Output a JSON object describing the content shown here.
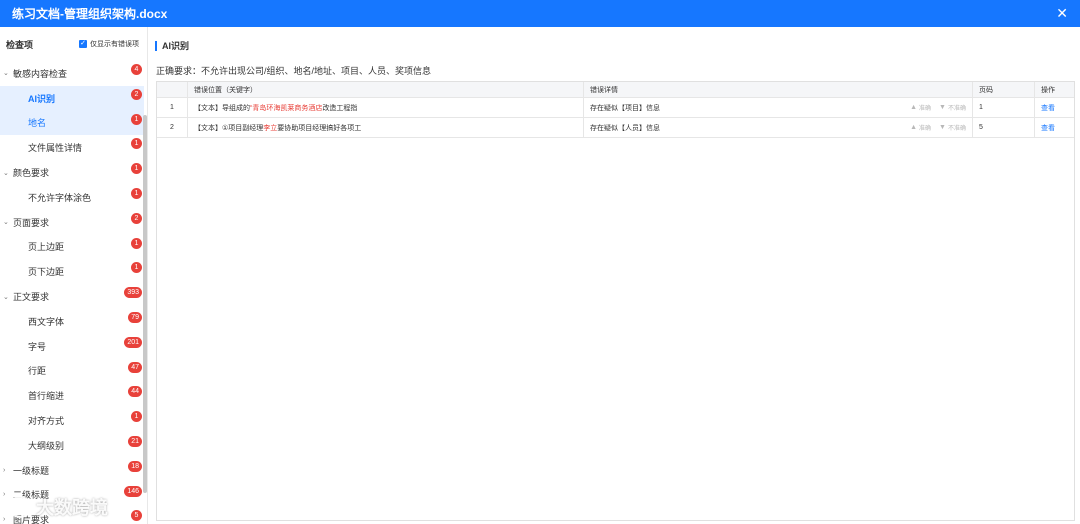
{
  "window": {
    "title": "练习文档-管理组织架构.docx"
  },
  "sidebar": {
    "header": "检查项",
    "filter_label": "仅显示有错误项",
    "items": [
      {
        "label": "敏感内容检查",
        "count": "4",
        "type": "group"
      },
      {
        "label": "AI识别",
        "count": "2",
        "type": "child"
      },
      {
        "label": "地名",
        "count": "1",
        "type": "child"
      },
      {
        "label": "文件属性详情",
        "count": "1",
        "type": "child"
      },
      {
        "label": "颜色要求",
        "count": "1",
        "type": "group"
      },
      {
        "label": "不允许字体涂色",
        "count": "1",
        "type": "child"
      },
      {
        "label": "页面要求",
        "count": "2",
        "type": "group"
      },
      {
        "label": "页上边距",
        "count": "1",
        "type": "child"
      },
      {
        "label": "页下边距",
        "count": "1",
        "type": "child"
      },
      {
        "label": "正文要求",
        "count": "393",
        "type": "group"
      },
      {
        "label": "西文字体",
        "count": "79",
        "type": "child"
      },
      {
        "label": "字号",
        "count": "201",
        "type": "child"
      },
      {
        "label": "行距",
        "count": "47",
        "type": "child"
      },
      {
        "label": "首行缩进",
        "count": "44",
        "type": "child"
      },
      {
        "label": "对齐方式",
        "count": "1",
        "type": "child"
      },
      {
        "label": "大纲级别",
        "count": "21",
        "type": "child"
      },
      {
        "label": "一级标题",
        "count": "18",
        "type": "group"
      },
      {
        "label": "二级标题",
        "count": "146",
        "type": "group"
      },
      {
        "label": "图片要求",
        "count": "5",
        "type": "group"
      }
    ]
  },
  "main": {
    "section_title": "AI识别",
    "requirement": "正确要求：不允许出现公司/组织、地名/地址、项目、人员、奖项信息",
    "table": {
      "headers": {
        "index": "",
        "location": "错误位置（关键字）",
        "detail": "错误详情",
        "page": "页码",
        "action": "操作"
      },
      "rows": [
        {
          "index": "1",
          "prefix": "【文本】导组成的",
          "keyword": "“青岛环海凯莱商务酒店",
          "suffix": "改造工程指",
          "detail": "存在疑似【项目】信息",
          "accurate": "准确",
          "inaccurate": "不准确",
          "page": "1",
          "action": "查看"
        },
        {
          "index": "2",
          "prefix": "【文本】①项目副经理",
          "keyword": "李立",
          "suffix": "要协助项目经理搞好各项工",
          "detail": "存在疑似【人员】信息",
          "accurate": "准确",
          "inaccurate": "不准确",
          "page": "5",
          "action": "查看"
        }
      ]
    }
  },
  "watermark": {
    "text": "大数跨境"
  },
  "icons": {
    "close": "close-icon",
    "thumb_up": "thumb-up-icon",
    "thumb_down": "thumb-down-icon",
    "caret": "chevron-down-icon",
    "checkbox": "checkbox-checked-icon"
  },
  "colors": {
    "accent": "#1677ff",
    "badge": "#e8413a",
    "keyword": "#e8413a"
  }
}
